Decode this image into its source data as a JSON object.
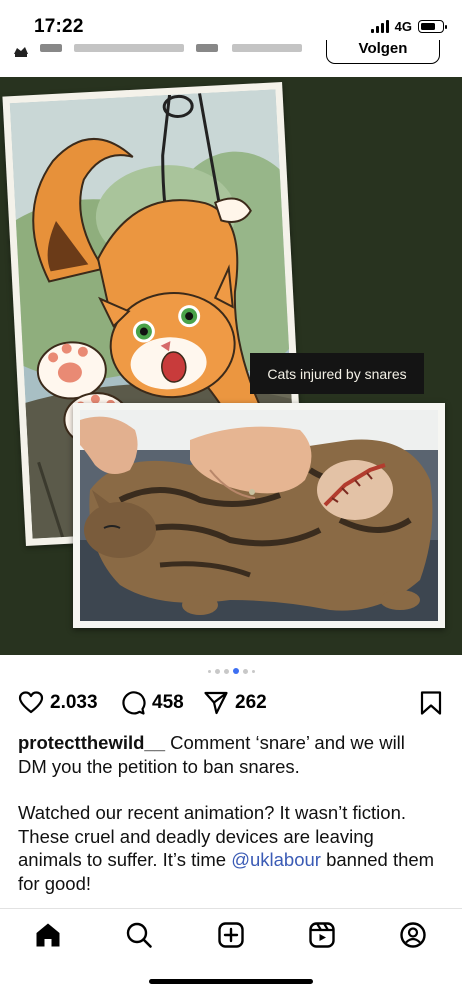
{
  "status_bar": {
    "time": "17:22",
    "network": "4G"
  },
  "post_header": {
    "follow_label": "Volgen"
  },
  "media": {
    "overlay_caption": "Cats injured by snares",
    "background_color": "#28331f",
    "carousel": {
      "total_dots": 6,
      "active_index": 3
    }
  },
  "actions": {
    "likes": "2.033",
    "comments": "458",
    "shares": "262",
    "icons": [
      "heart-icon",
      "comment-icon",
      "send-icon",
      "bookmark-icon"
    ]
  },
  "caption": {
    "username": "protectthewild__",
    "line1": " Comment ‘snare’ and we will DM you the petition to ban snares.",
    "para2_before": "Watched our recent animation? It wasn’t fiction. These cruel and deadly devices are leaving animals to suffer. It’s time ",
    "mention": "@uklabour",
    "para2_after": " banned them for good!",
    "mention_color": "#3b5bb5"
  },
  "bottom_nav": {
    "items": [
      "home-icon",
      "search-icon",
      "create-icon",
      "reels-icon",
      "profile-icon"
    ]
  }
}
